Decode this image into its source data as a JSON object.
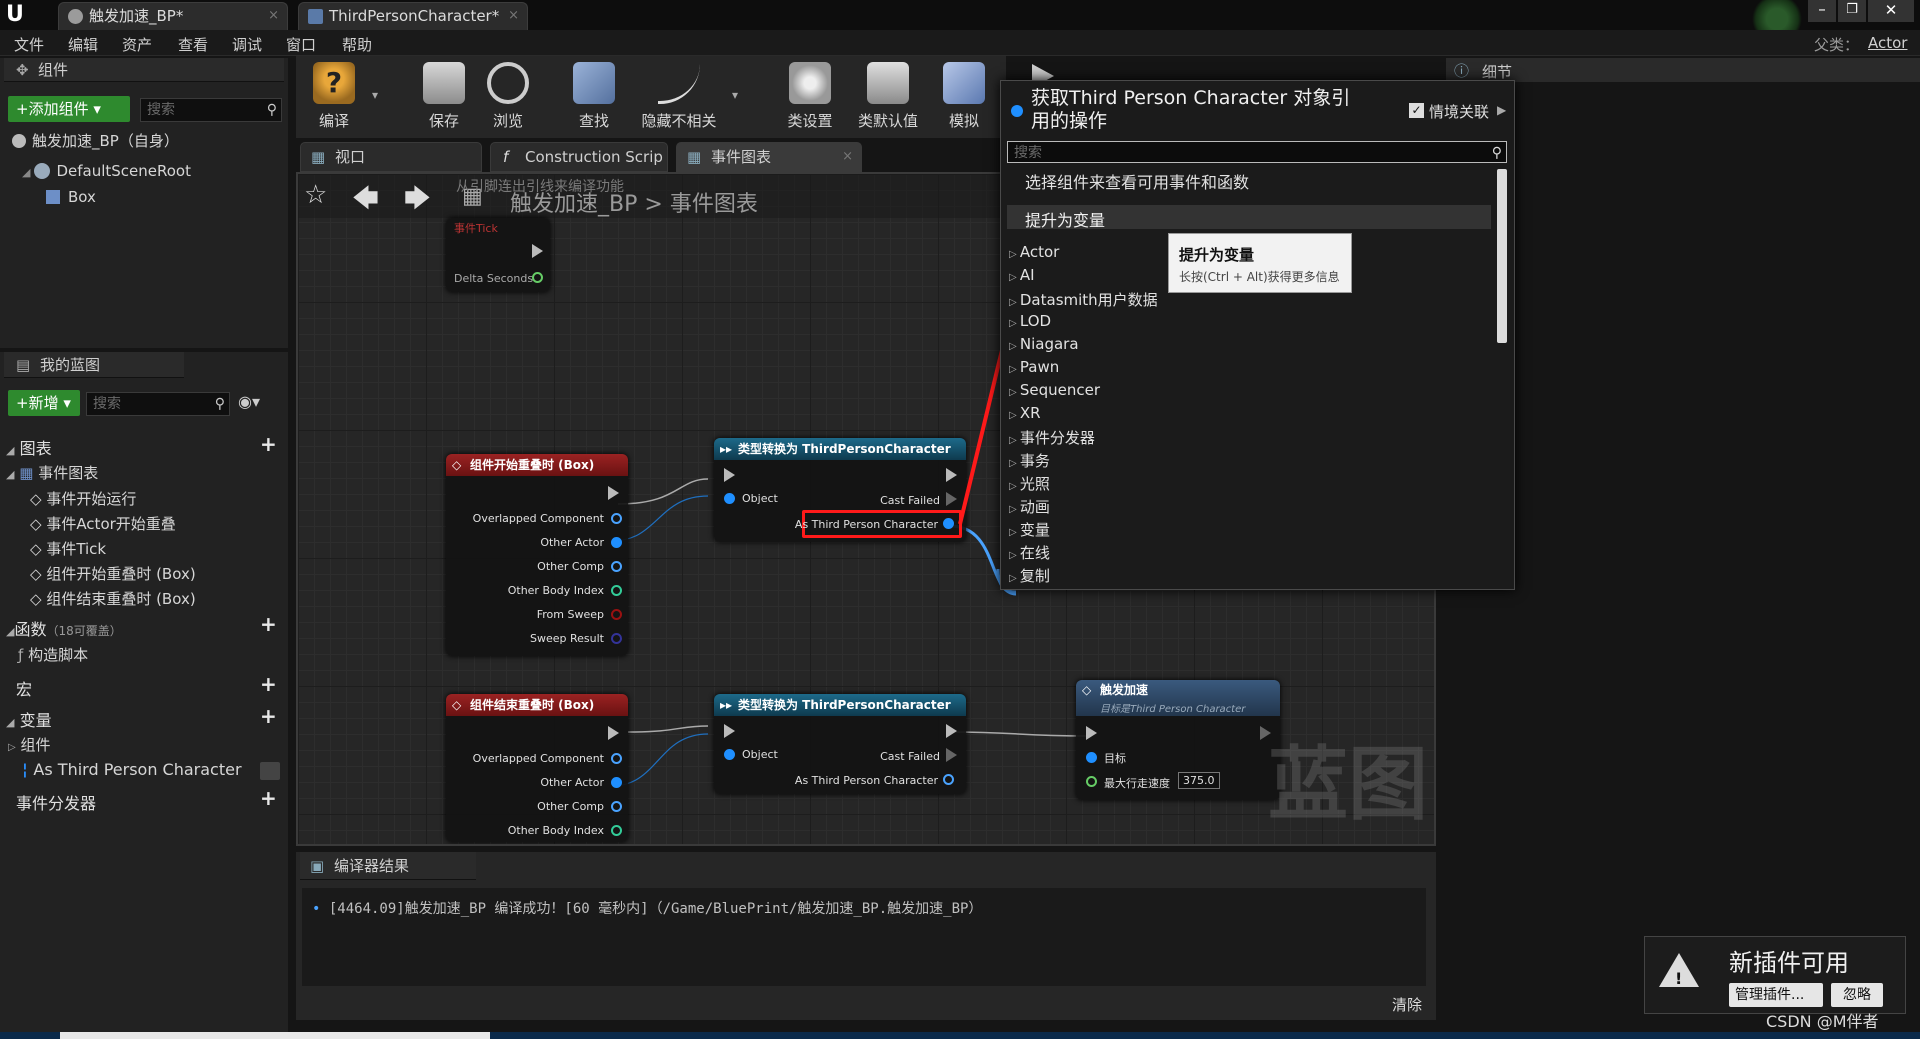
{
  "title_tabs": [
    {
      "label": "触发加速_BP*"
    },
    {
      "label": "ThirdPersonCharacter*"
    }
  ],
  "parent_class": {
    "label": "父类：",
    "value": "Actor"
  },
  "menu": [
    "文件",
    "编辑",
    "资产",
    "查看",
    "调试",
    "窗口",
    "帮助"
  ],
  "components": {
    "header": "组件",
    "add_button": "+添加组件 ▾",
    "search_placeholder": "搜索",
    "self_item": "触发加速_BP（自身）",
    "root": "DefaultSceneRoot",
    "box": "Box"
  },
  "myblueprint": {
    "header": "我的蓝图",
    "new_button": "+新增 ▾",
    "search_placeholder": "搜索",
    "graphs_label": "图表",
    "event_graph": "事件图表",
    "events": [
      "事件开始运行",
      "事件Actor开始重叠",
      "事件Tick",
      "组件开始重叠时 (Box)",
      "组件结束重叠时 (Box)"
    ],
    "functions_label": "函数",
    "functions_count": "（18可覆盖）",
    "construct": "构造脚本",
    "macros": "宏",
    "variables": "变量",
    "components_group": "组件",
    "variable_item": "As Third Person Character",
    "dispatchers": "事件分发器"
  },
  "toolbar": [
    {
      "label": "编译",
      "icon": "compile-icon"
    },
    {
      "label": "保存",
      "icon": "save-icon"
    },
    {
      "label": "浏览",
      "icon": "browse-icon"
    },
    {
      "label": "查找",
      "icon": "find-icon"
    },
    {
      "label": "隐藏不相关",
      "icon": "hide-unrelated-icon"
    },
    {
      "label": "类设置",
      "icon": "class-settings-icon"
    },
    {
      "label": "类默认值",
      "icon": "class-defaults-icon"
    },
    {
      "label": "模拟",
      "icon": "simulate-icon"
    }
  ],
  "graph_tabs": [
    "视口",
    "Construction Scrip",
    "事件图表"
  ],
  "breadcrumb": {
    "root": "触发加速_BP",
    "sep": ">",
    "page": "事件图表"
  },
  "graph_hint": "从引脚连出引线来编译功能",
  "watermark": "蓝图",
  "nodes": {
    "tick": {
      "title": "事件Tick",
      "pin": "Delta Seconds"
    },
    "begin": {
      "title": "组件开始重叠时 (Box)",
      "pins": [
        "Overlapped Component",
        "Other Actor",
        "Other Comp",
        "Other Body Index",
        "From Sweep",
        "Sweep Result"
      ]
    },
    "cast1": {
      "title": "类型转换为 ThirdPersonCharacter",
      "object": "Object",
      "cast_failed": "Cast Failed",
      "as": "As Third Person Character"
    },
    "end": {
      "title": "组件结束重叠时 (Box)",
      "pins": [
        "Overlapped Component",
        "Other Actor",
        "Other Comp",
        "Other Body Index"
      ]
    },
    "cast2": {
      "title": "类型转换为 ThirdPersonCharacter",
      "object": "Object",
      "cast_failed": "Cast Failed",
      "as": "As Third Person Character"
    },
    "speed": {
      "title": "触发加速",
      "subtitle": "目标是Third Person Character",
      "target": "目标",
      "max_speed_label": "最大行走速度",
      "max_speed_value": "375.0"
    }
  },
  "compiler": {
    "tab": "编译器结果",
    "message": "[4464.09]触发加速_BP 编译成功！[60 毫秒内]（/Game/BluePrint/触发加速_BP.触发加速_BP）",
    "clear": "清除"
  },
  "popup": {
    "title": "获取Third Person Character 对象引用的操作",
    "context_label": "情境关联",
    "search_placeholder": "搜索",
    "hint": "选择组件来查看可用事件和函数",
    "promote": "提升为变量",
    "categories": [
      "Actor",
      "AI",
      "Datasmith用户数据",
      "LOD",
      "Niagara",
      "Pawn",
      "Sequencer",
      "XR",
      "事件分发器",
      "事务",
      "光照",
      "动画",
      "变量",
      "在线",
      "复制"
    ]
  },
  "tooltip": {
    "title": "提升为变量",
    "body": "长按(Ctrl + Alt)获得更多信息"
  },
  "details": {
    "header": "细节"
  },
  "notification": {
    "title": "新插件可用",
    "manage": "管理插件...",
    "ignore": "忽略"
  },
  "credit": "CSDN @M伴者",
  "colors": {
    "event_header": "#8b1a1a",
    "cast_header": "#15506a",
    "func_header": "#2f4f6e",
    "highlight": "#ff1a1a",
    "pin_blue": "#1f8fff"
  }
}
